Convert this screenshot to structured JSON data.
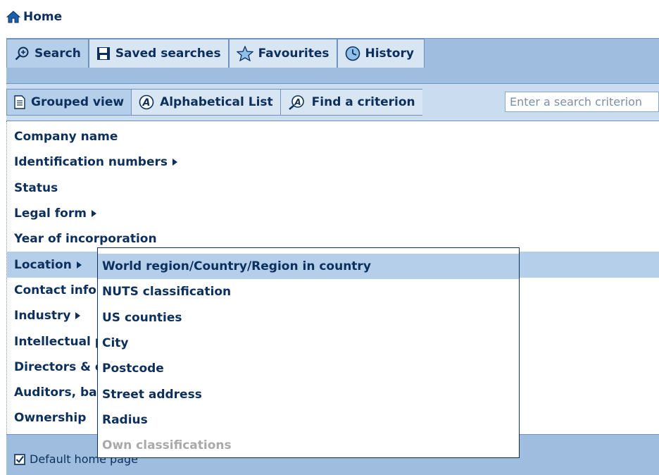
{
  "home": {
    "label": "Home"
  },
  "tabs": [
    {
      "label": "Search",
      "icon": "search-icon"
    },
    {
      "label": "Saved searches",
      "icon": "floppy-disk-icon"
    },
    {
      "label": "Favourites",
      "icon": "star-icon"
    },
    {
      "label": "History",
      "icon": "clock-icon"
    }
  ],
  "views": [
    {
      "label": "Grouped view",
      "icon": "document-icon"
    },
    {
      "label": "Alphabetical List",
      "icon": "alphabet-icon"
    }
  ],
  "find": {
    "label": "Find a criterion",
    "placeholder": "Enter a search criterion"
  },
  "criteria": [
    {
      "label": "Company name"
    },
    {
      "label": "Identification numbers"
    },
    {
      "label": "Status"
    },
    {
      "label": "Legal form"
    },
    {
      "label": "Year of incorporation"
    },
    {
      "label": "Location"
    },
    {
      "label": "Contact information"
    },
    {
      "label": "Industry"
    },
    {
      "label": "Intellectual property"
    },
    {
      "label": "Directors & contacts"
    },
    {
      "label": "Auditors, bankers & other advisors"
    },
    {
      "label": "Ownership"
    }
  ],
  "submenu": [
    {
      "label": "World region/Country/Region in country"
    },
    {
      "label": "NUTS classification"
    },
    {
      "label": "US counties"
    },
    {
      "label": "City"
    },
    {
      "label": "Postcode"
    },
    {
      "label": "Street address"
    },
    {
      "label": "Radius"
    },
    {
      "label": "Own classifications"
    }
  ],
  "footer": {
    "default_home_label": "Default home page"
  },
  "colors": {
    "primary": "#0c2f5c",
    "bar": "#9fbedf",
    "tab": "#d8e6f4",
    "highlight": "#b5cfeb",
    "disabled": "#a9a9a9"
  }
}
